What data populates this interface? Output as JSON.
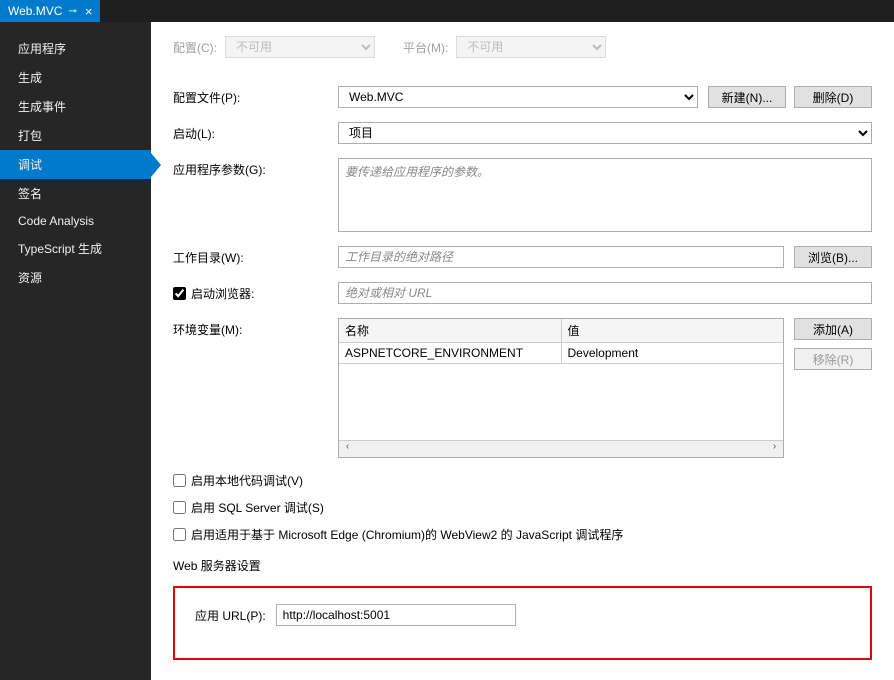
{
  "tab": {
    "title": "Web.MVC"
  },
  "sidebar": {
    "items": [
      {
        "label": "应用程序"
      },
      {
        "label": "生成"
      },
      {
        "label": "生成事件"
      },
      {
        "label": "打包"
      },
      {
        "label": "调试"
      },
      {
        "label": "签名"
      },
      {
        "label": "Code Analysis"
      },
      {
        "label": "TypeScript 生成"
      },
      {
        "label": "资源"
      }
    ],
    "activeIndex": 4
  },
  "top": {
    "config_label": "配置(C):",
    "config_value": "不可用",
    "platform_label": "平台(M):",
    "platform_value": "不可用"
  },
  "form": {
    "profile_label": "配置文件(P):",
    "profile_value": "Web.MVC",
    "new_btn": "新建(N)...",
    "delete_btn": "删除(D)",
    "launch_label": "启动(L):",
    "launch_value": "项目",
    "args_label": "应用程序参数(G):",
    "args_placeholder": "要传递给应用程序的参数。",
    "workdir_label": "工作目录(W):",
    "workdir_placeholder": "工作目录的绝对路径",
    "browse_btn": "浏览(B)...",
    "launch_browser_label": "启动浏览器:",
    "launch_browser_placeholder": "绝对或相对 URL",
    "env_label": "环境变量(M):",
    "env_header_name": "名称",
    "env_header_value": "值",
    "env_rows": [
      {
        "name": "ASPNETCORE_ENVIRONMENT",
        "value": "Development"
      }
    ],
    "add_btn": "添加(A)",
    "remove_btn": "移除(R)",
    "native_debug_label": "启用本地代码调试(V)",
    "sql_debug_label": "启用 SQL Server 调试(S)",
    "webview2_label": "启用适用于基于 Microsoft Edge (Chromium)的 WebView2 的 JavaScript 调试程序",
    "web_server_title": "Web 服务器设置",
    "app_url_label": "应用 URL(P):",
    "app_url_value": "http://localhost:5001"
  }
}
